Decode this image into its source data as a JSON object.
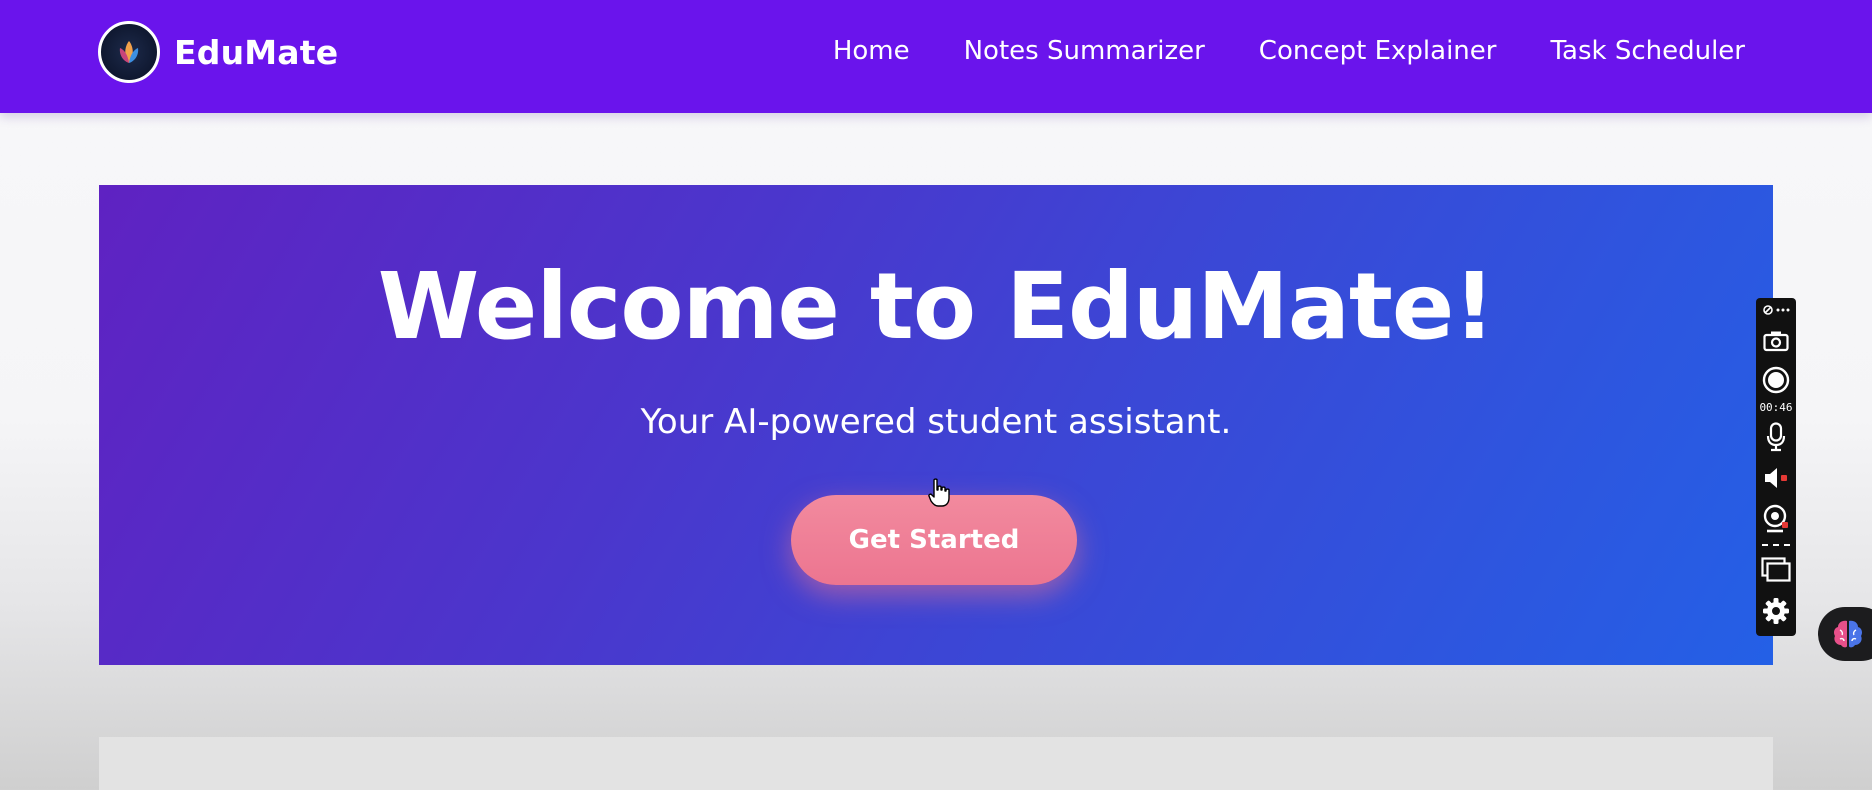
{
  "header": {
    "brand_name": "EduMate",
    "nav": [
      {
        "label": "Home"
      },
      {
        "label": "Notes Summarizer"
      },
      {
        "label": "Concept Explainer"
      },
      {
        "label": "Task Scheduler"
      }
    ]
  },
  "hero": {
    "title": "Welcome to EduMate!",
    "subtitle": "Your AI-powered student assistant.",
    "cta_label": "Get Started"
  },
  "recorder_toolbar": {
    "timer": "00:46",
    "icons": [
      "pin-icon",
      "more-icon",
      "camera-icon",
      "record-icon",
      "microphone-icon",
      "speaker-icon",
      "webcam-icon",
      "window-icon",
      "gear-icon"
    ]
  },
  "floating_assistant": {
    "icon": "brain-icon"
  },
  "colors": {
    "navbar": "#6a14ec",
    "hero_gradient_start": "#5f22c2",
    "hero_gradient_end": "#2460e6",
    "cta": "#ec7590"
  }
}
